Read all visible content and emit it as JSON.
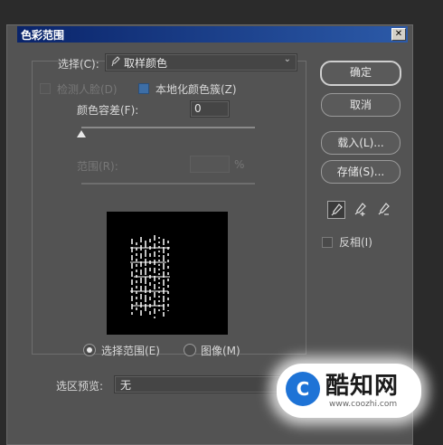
{
  "window": {
    "title": "色彩范围",
    "close_glyph": "✕"
  },
  "select": {
    "label": "选择(C):",
    "value": "取样颜色",
    "icon": "eyedropper-icon"
  },
  "options": {
    "detect_faces": "检测人脸(D)",
    "localized_clusters": "本地化颜色簇(Z)"
  },
  "fuzziness": {
    "label": "颜色容差(F):",
    "value": "0",
    "level": 0.0
  },
  "range": {
    "label": "范围(R):",
    "value": "",
    "unit": "%"
  },
  "buttons": {
    "ok": "确定",
    "cancel": "取消",
    "load": "载入(L)...",
    "save": "存储(S)..."
  },
  "tools": [
    "eyedropper-icon",
    "eyedropper-plus-icon",
    "eyedropper-minus-icon"
  ],
  "invert": {
    "label": "反相(I)",
    "checked": false
  },
  "preview_mode": {
    "selection": "选择范围(E)",
    "image": "图像(M)",
    "selected": "selection"
  },
  "selection_preview": {
    "label": "选区预览:",
    "value": "无"
  },
  "watermark": {
    "brand": "酷知网",
    "logo_letter": "C",
    "url": "www.coozhi.com"
  }
}
